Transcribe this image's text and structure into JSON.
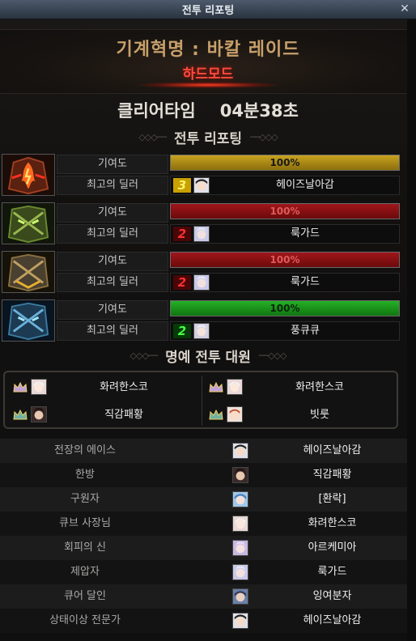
{
  "window": {
    "title": "전투 리포팅",
    "close_icon": "close-icon"
  },
  "header": {
    "dungeon": "기계혁명 : 바칼 레이드",
    "mode": "하드모드"
  },
  "clear_time": {
    "label": "클리어타임",
    "value": "04분38초"
  },
  "battle_section": {
    "title": "전투 리포팅"
  },
  "bosses": [
    {
      "icon": "fire-mask-boss-icon",
      "contribution_label": "기여도",
      "contribution": "100%",
      "contribution_fraction": 1.0,
      "bar_color": "#c8a320",
      "top_dealer_label": "최고의 딜러",
      "rank": "3",
      "dealer": "헤이즈날아감"
    },
    {
      "icon": "green-mask-boss-icon",
      "contribution_label": "기여도",
      "contribution": "100%",
      "contribution_fraction": 1.0,
      "bar_color": "#a0161a",
      "top_dealer_label": "최고의 딜러",
      "rank": "2",
      "dealer": "룩가드"
    },
    {
      "icon": "gold-mask-boss-icon",
      "contribution_label": "기여도",
      "contribution": "100%",
      "contribution_fraction": 1.0,
      "bar_color": "#a0161a",
      "top_dealer_label": "최고의 딜러",
      "rank": "2",
      "dealer": "룩가드"
    },
    {
      "icon": "ice-mask-boss-icon",
      "contribution_label": "기여도",
      "contribution": "100%",
      "contribution_fraction": 1.0,
      "bar_color": "#25b025",
      "top_dealer_label": "최고의 딜러",
      "rank": "2",
      "dealer": "풍큐큐"
    }
  ],
  "honor_section": {
    "title": "명예 전투 대원",
    "members": [
      "화려한스코",
      "화려한스코",
      "직감패황",
      "빗룻"
    ]
  },
  "awards": [
    {
      "title": "전장의 에이스",
      "name": "헤이즈날아감"
    },
    {
      "title": "한방",
      "name": "직감패황"
    },
    {
      "title": "구원자",
      "name": "[환락]"
    },
    {
      "title": "큐브 사장님",
      "name": "화려한스코"
    },
    {
      "title": "회피의 신",
      "name": "아르케미아"
    },
    {
      "title": "제압자",
      "name": "룩가드"
    },
    {
      "title": "큐어 달인",
      "name": "잉여분자"
    },
    {
      "title": "상태이상 전문가",
      "name": "헤이즈날아감"
    }
  ]
}
